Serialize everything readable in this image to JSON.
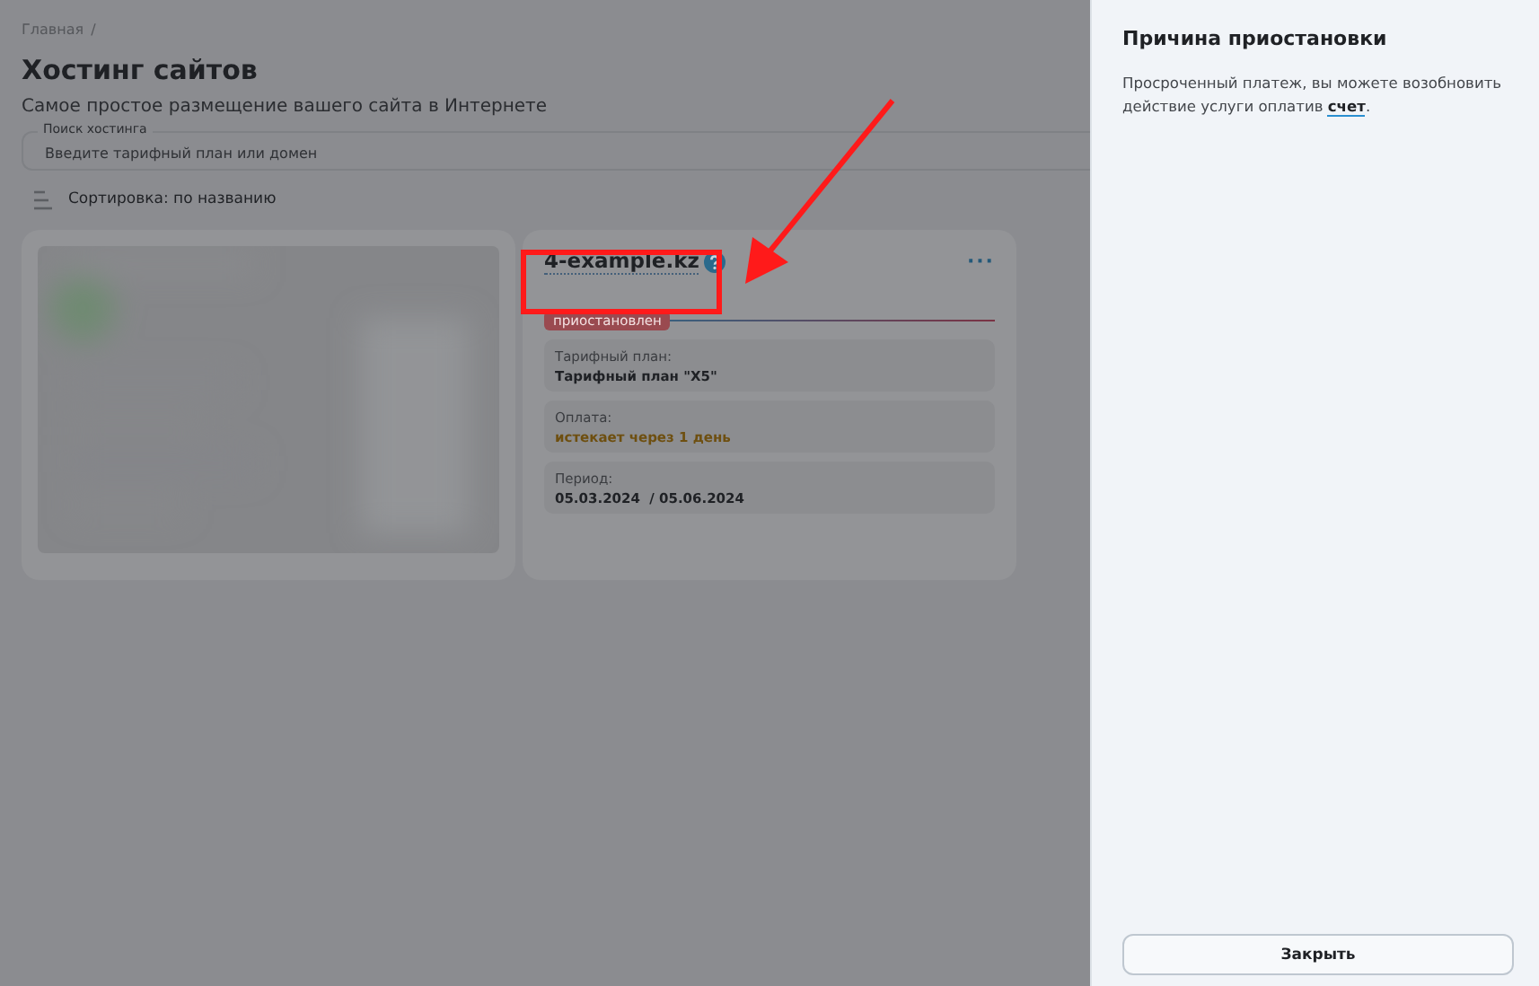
{
  "breadcrumb": [
    "Главная",
    "/"
  ],
  "title": "Хостинг сайтов",
  "subtitle": "Самое простое размещение вашего сайта в Интернете",
  "search": {
    "label": "Поиск хостинга",
    "placeholder": "Введите тарифный план или домен"
  },
  "sort": {
    "label": "Сортировка: по названию"
  },
  "cards": [
    {
      "kind": "picture"
    },
    {
      "kind": "hosting",
      "domain": "4-example.kz",
      "menu": "···",
      "status": "приостановлен",
      "fields": [
        {
          "label": "Тарифный план:",
          "value": "Тарифный план \"X5\"",
          "kind": "plain"
        },
        {
          "label": "Оплата:",
          "value": "истекает через 1 день",
          "kind": "warning"
        },
        {
          "label": "Период:",
          "value": "05.03.2024  / 05.06.2024",
          "kind": "plain"
        }
      ]
    }
  ],
  "panel": {
    "title": "Причина приостановки",
    "text_before": "Просроченный платеж, вы можете возобновить действие услуги оплатив ",
    "link": "счет",
    "text_after": ".",
    "button": "Закрыть"
  }
}
